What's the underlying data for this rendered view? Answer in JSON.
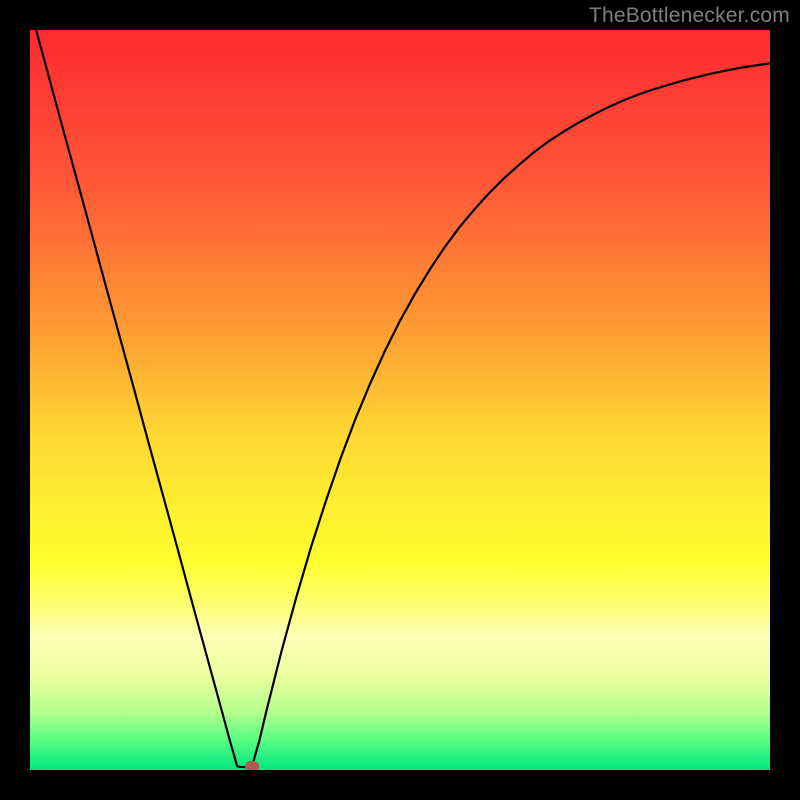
{
  "attribution": "TheBottlenecker.com",
  "chart_data": {
    "type": "line",
    "title": "",
    "xlabel": "",
    "ylabel": "",
    "xlim": [
      0,
      1
    ],
    "ylim": [
      0,
      1
    ],
    "x": [
      0.0,
      0.02,
      0.04,
      0.06,
      0.08,
      0.1,
      0.12,
      0.14,
      0.16,
      0.18,
      0.2,
      0.22,
      0.24,
      0.26,
      0.27,
      0.28,
      0.285,
      0.29,
      0.295,
      0.3,
      0.31,
      0.32,
      0.34,
      0.36,
      0.38,
      0.4,
      0.42,
      0.44,
      0.46,
      0.48,
      0.5,
      0.52,
      0.54,
      0.56,
      0.58,
      0.6,
      0.62,
      0.64,
      0.66,
      0.68,
      0.7,
      0.72,
      0.74,
      0.76,
      0.78,
      0.8,
      0.82,
      0.84,
      0.86,
      0.88,
      0.9,
      0.92,
      0.94,
      0.96,
      0.98,
      1.0
    ],
    "values": [
      1.03,
      0.957,
      0.883,
      0.81,
      0.737,
      0.663,
      0.59,
      0.517,
      0.443,
      0.37,
      0.297,
      0.223,
      0.15,
      0.077,
      0.04,
      0.005,
      0.004,
      0.004,
      0.004,
      0.005,
      0.04,
      0.082,
      0.161,
      0.234,
      0.302,
      0.364,
      0.422,
      0.475,
      0.523,
      0.567,
      0.607,
      0.643,
      0.676,
      0.706,
      0.733,
      0.757,
      0.779,
      0.799,
      0.817,
      0.834,
      0.849,
      0.862,
      0.874,
      0.885,
      0.895,
      0.904,
      0.912,
      0.919,
      0.925,
      0.931,
      0.936,
      0.941,
      0.945,
      0.949,
      0.952,
      0.955
    ],
    "marker": {
      "x": 0.3,
      "y": 0.005,
      "color": "#b2584f"
    },
    "gradient_stops": [
      {
        "pct": 0,
        "color": "#fe2a2f"
      },
      {
        "pct": 21,
        "color": "#ff5838"
      },
      {
        "pct": 42,
        "color": "#ffa233"
      },
      {
        "pct": 55,
        "color": "#fed933"
      },
      {
        "pct": 72,
        "color": "#feff2e"
      },
      {
        "pct": 78,
        "color": "#feff77"
      },
      {
        "pct": 82,
        "color": "#fdffb6"
      },
      {
        "pct": 87,
        "color": "#eeffa1"
      },
      {
        "pct": 92,
        "color": "#b7ff8e"
      },
      {
        "pct": 96,
        "color": "#58fd83"
      },
      {
        "pct": 100,
        "color": "#00e780"
      }
    ]
  }
}
